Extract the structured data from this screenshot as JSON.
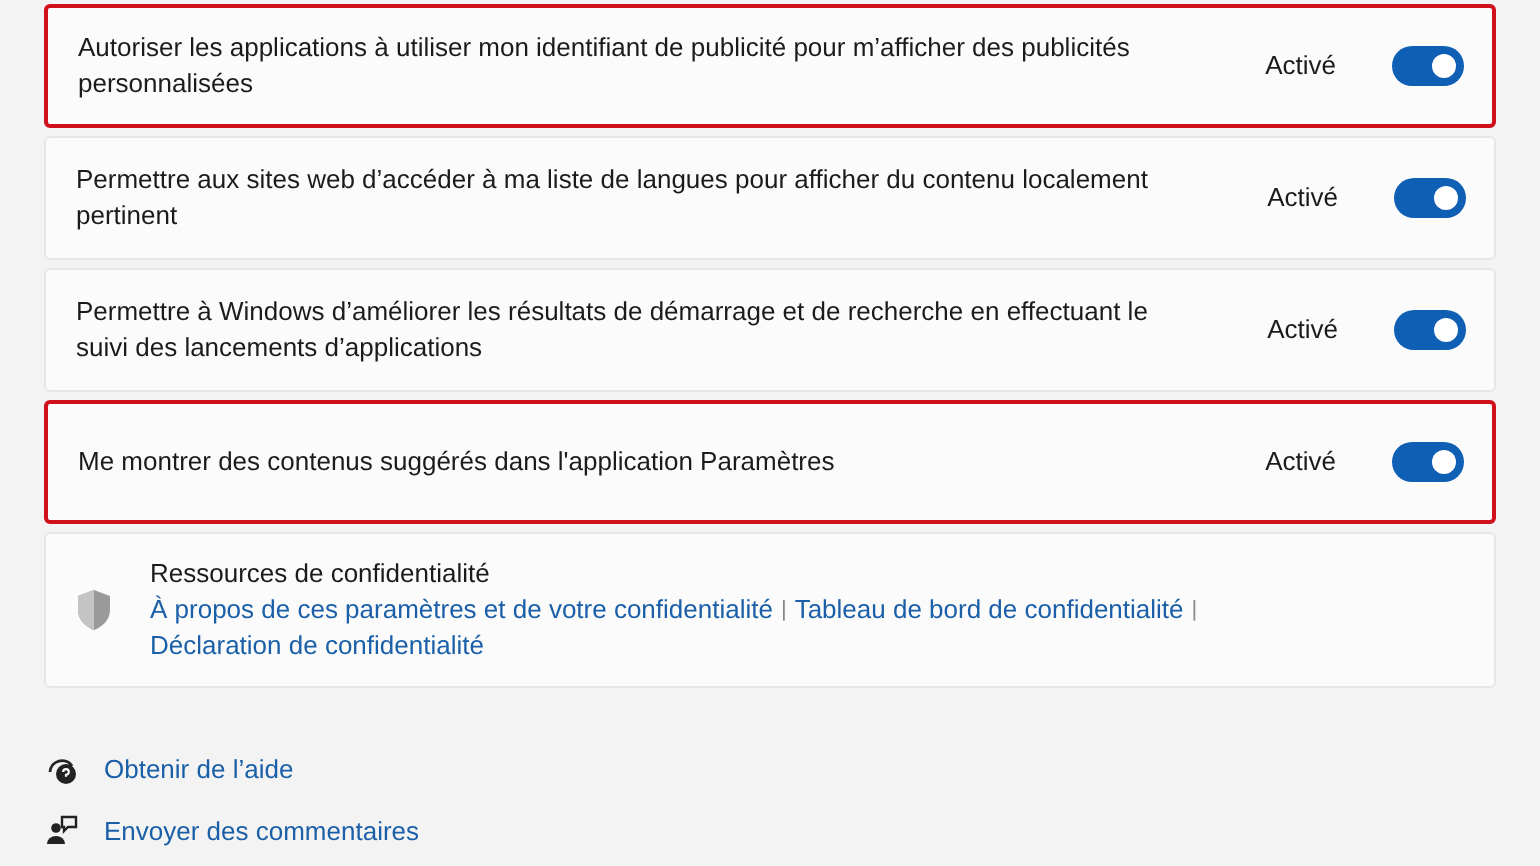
{
  "settings": [
    {
      "label": "Autoriser les applications à utiliser mon identifiant de publicité pour m’afficher des publicités personnalisées",
      "status": "Activé",
      "on": true,
      "highlighted": true
    },
    {
      "label": "Permettre aux sites web d’accéder à ma liste de langues pour afficher du contenu localement pertinent",
      "status": "Activé",
      "on": true,
      "highlighted": false
    },
    {
      "label": "Permettre à Windows d’améliorer les résultats de démarrage et de recherche en effectuant le suivi des lancements d’applications",
      "status": "Activé",
      "on": true,
      "highlighted": false
    },
    {
      "label": "Me montrer des contenus suggérés dans l'application Paramètres",
      "status": "Activé",
      "on": true,
      "highlighted": true
    }
  ],
  "resources": {
    "title": "Ressources de confidentialité",
    "items": [
      {
        "kind": "link",
        "text": "À propos de ces paramètres et de votre confidentialité"
      },
      {
        "kind": "separator",
        "text": "|"
      },
      {
        "kind": "link",
        "text": "Tableau de bord de confidentialité"
      },
      {
        "kind": "separator",
        "text": "|"
      },
      {
        "kind": "link",
        "text": "Déclaration de confidentialité"
      }
    ]
  },
  "help_links": [
    {
      "kind": "help",
      "text": "Obtenir de l’aide"
    },
    {
      "kind": "feedback",
      "text": "Envoyer des commentaires"
    }
  ]
}
